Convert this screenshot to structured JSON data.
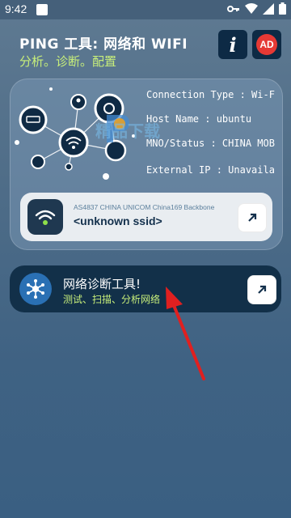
{
  "status_bar": {
    "time": "9:42",
    "icons": [
      "key-icon",
      "wifi-icon",
      "signal-icon",
      "battery-icon"
    ]
  },
  "header": {
    "title": "PING 工具: 网络和 WIFI",
    "subtitle": "分析。诊断。配置",
    "info_label": "i",
    "ad_label": "AD"
  },
  "connection": {
    "connection_type": "Connection Type : Wi-F",
    "host_name": "Host Name : ubuntu",
    "mno_status": "MNO/Status : CHINA MOB",
    "external_ip": "External IP : Unavaila"
  },
  "watermark": "精品下载",
  "wifi_card": {
    "backbone": "AS4837 CHINA UNICOM China169 Backbone",
    "ssid": "<unknown ssid>"
  },
  "tool_card": {
    "title": "网络诊断工具!",
    "subtitle": "测试、扫描、分析网络"
  },
  "colors": {
    "accent_green": "#c8ef7a",
    "dark_navy": "#123049",
    "ad_red": "#e53935",
    "annotation_arrow": "#e02020"
  }
}
